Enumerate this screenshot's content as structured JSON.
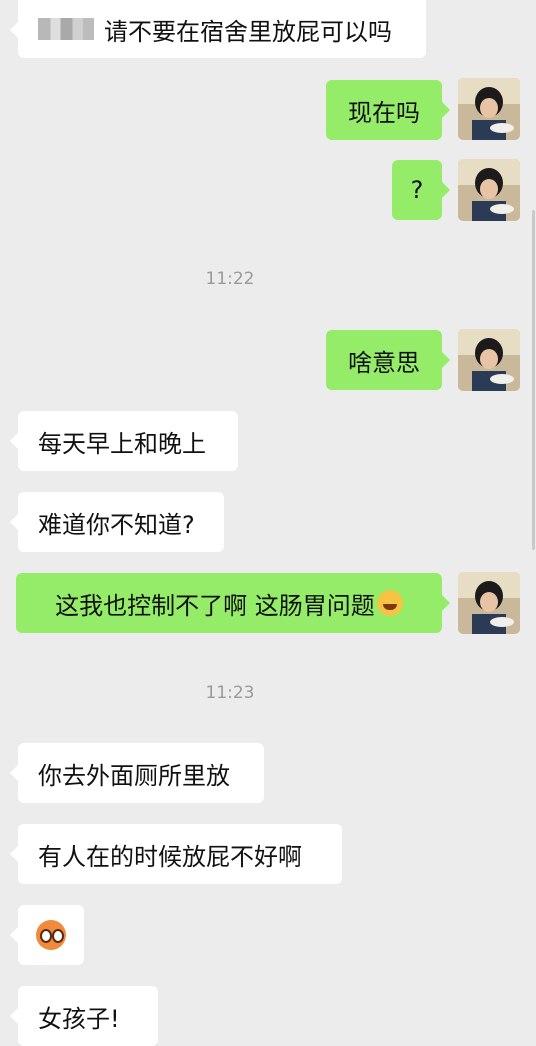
{
  "chat": {
    "messages": [
      {
        "side": "in",
        "text": "请不要在宿舍里放屁可以吗",
        "sender_blurred": true
      },
      {
        "side": "out",
        "text": "现在吗"
      },
      {
        "side": "out",
        "text": "?"
      },
      {
        "side": "time",
        "text": "11:22"
      },
      {
        "side": "out",
        "text": "啥意思"
      },
      {
        "side": "in",
        "text": "每天早上和晚上"
      },
      {
        "side": "in",
        "text": "难道你不知道?"
      },
      {
        "side": "out",
        "text": "这我也控制不了啊  这肠胃问题",
        "emoji": "laughing-tears-icon"
      },
      {
        "side": "time",
        "text": "11:23"
      },
      {
        "side": "in",
        "text": "你去外面厕所里放"
      },
      {
        "side": "in",
        "text": "有人在的时候放屁不好啊"
      },
      {
        "side": "in",
        "text": "",
        "emoji": "flushed-face-icon"
      },
      {
        "side": "in",
        "text": "女孩子!"
      }
    ]
  },
  "colors": {
    "background": "#ececec",
    "incoming_bubble": "#ffffff",
    "outgoing_bubble": "#95ec69",
    "timestamp": "#9a9a9a"
  }
}
